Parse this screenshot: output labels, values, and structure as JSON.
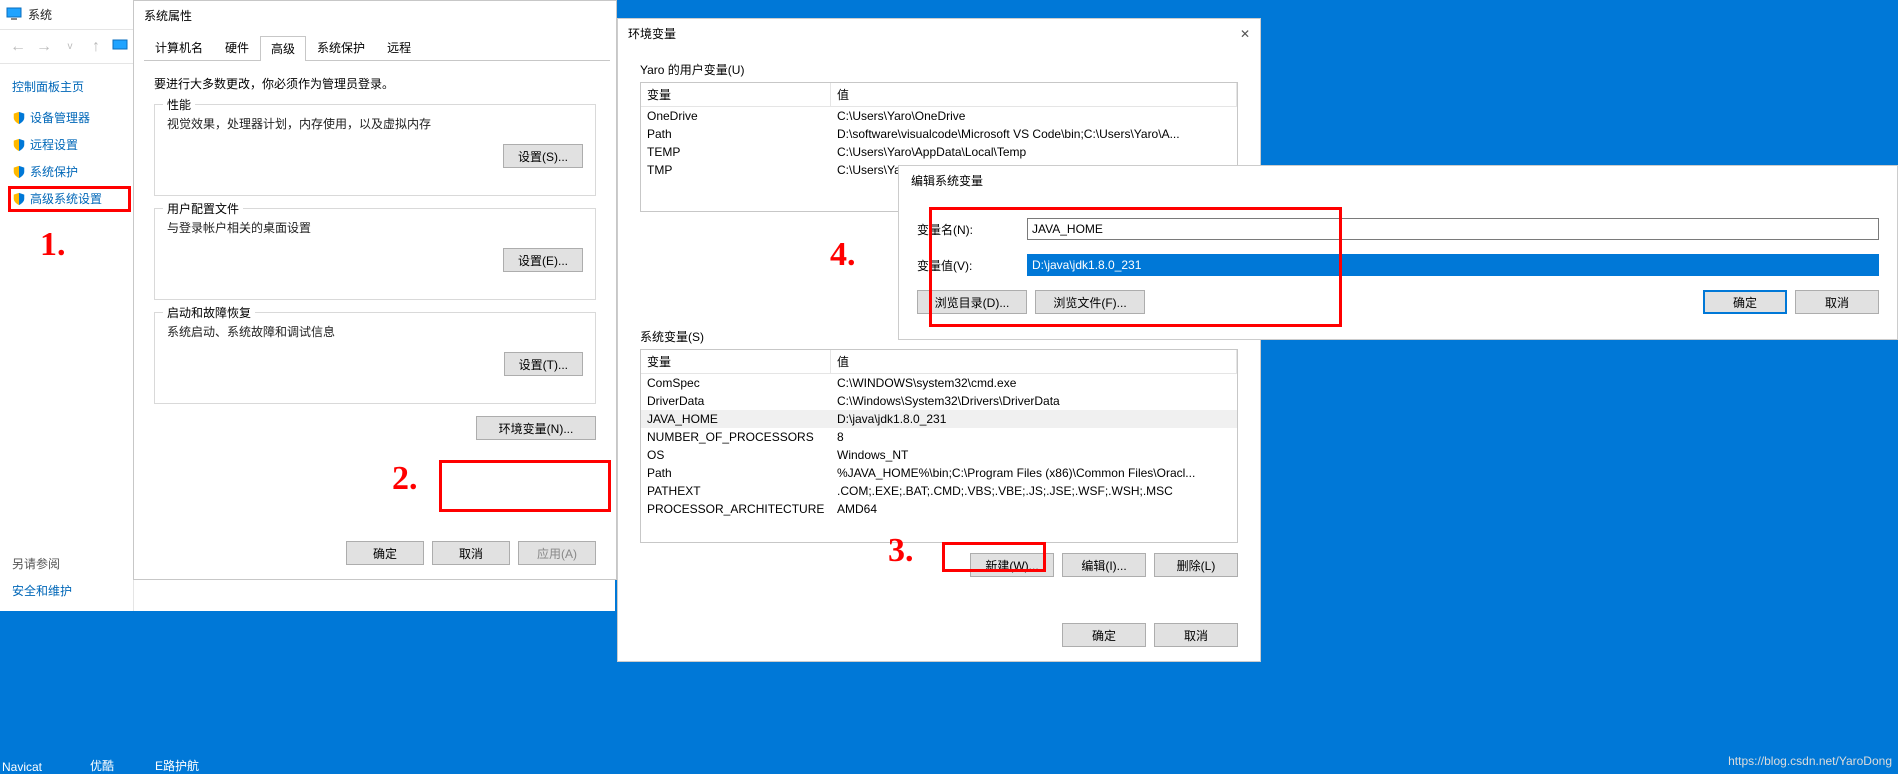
{
  "explorer": {
    "title": "系统",
    "sidebar_title": "控制面板主页",
    "sidebar_items": [
      "设备管理器",
      "远程设置",
      "系统保护",
      "高级系统设置"
    ],
    "see_also_title": "另请参阅",
    "see_also_items": [
      "安全和维护"
    ]
  },
  "sysprops": {
    "title": "系统属性",
    "tabs": [
      "计算机名",
      "硬件",
      "高级",
      "系统保护",
      "远程"
    ],
    "active_tab": 2,
    "admin_note": "要进行大多数更改，你必须作为管理员登录。",
    "perf_title": "性能",
    "perf_text": "视觉效果，处理器计划，内存使用，以及虚拟内存",
    "perf_btn": "设置(S)...",
    "profile_title": "用户配置文件",
    "profile_text": "与登录帐户相关的桌面设置",
    "profile_btn": "设置(E)...",
    "startup_title": "启动和故障恢复",
    "startup_text": "系统启动、系统故障和调试信息",
    "startup_btn": "设置(T)...",
    "envvars_btn": "环境变量(N)...",
    "ok": "确定",
    "cancel": "取消",
    "apply": "应用(A)"
  },
  "envvars": {
    "title": "环境变量",
    "user_label": "Yaro 的用户变量(U)",
    "col_var": "变量",
    "col_val": "值",
    "user_vars": [
      {
        "name": "OneDrive",
        "value": "C:\\Users\\Yaro\\OneDrive"
      },
      {
        "name": "Path",
        "value": "D:\\software\\visualcode\\Microsoft VS Code\\bin;C:\\Users\\Yaro\\A..."
      },
      {
        "name": "TEMP",
        "value": "C:\\Users\\Yaro\\AppData\\Local\\Temp"
      },
      {
        "name": "TMP",
        "value": "C:\\Users\\Yaro\\AppData\\Local\\Temp"
      }
    ],
    "sys_label": "系统变量(S)",
    "sys_vars": [
      {
        "name": "ComSpec",
        "value": "C:\\WINDOWS\\system32\\cmd.exe"
      },
      {
        "name": "DriverData",
        "value": "C:\\Windows\\System32\\Drivers\\DriverData"
      },
      {
        "name": "JAVA_HOME",
        "value": "D:\\java\\jdk1.8.0_231",
        "hl": true
      },
      {
        "name": "NUMBER_OF_PROCESSORS",
        "value": "8"
      },
      {
        "name": "OS",
        "value": "Windows_NT"
      },
      {
        "name": "Path",
        "value": "%JAVA_HOME%\\bin;C:\\Program Files (x86)\\Common Files\\Oracl..."
      },
      {
        "name": "PATHEXT",
        "value": ".COM;.EXE;.BAT;.CMD;.VBS;.VBE;.JS;.JSE;.WSF;.WSH;.MSC"
      },
      {
        "name": "PROCESSOR_ARCHITECTURE",
        "value": "AMD64"
      }
    ],
    "new_btn": "新建(W)...",
    "edit_btn": "编辑(I)...",
    "del_btn": "删除(L)",
    "ok": "确定",
    "cancel": "取消"
  },
  "editvar": {
    "title": "编辑系统变量",
    "name_label": "变量名(N):",
    "name_value": "JAVA_HOME",
    "value_label": "变量值(V):",
    "value_value": "D:\\java\\jdk1.8.0_231",
    "browse_dir": "浏览目录(D)...",
    "browse_file": "浏览文件(F)...",
    "ok": "确定",
    "cancel": "取消"
  },
  "annotations": {
    "l1": "1.",
    "l2": "2.",
    "l3": "3.",
    "l4": "4."
  },
  "taskbar": {
    "items": [
      "Navicat",
      "优酷",
      "E路护航"
    ]
  },
  "watermark": "https://blog.csdn.net/YaroDong"
}
